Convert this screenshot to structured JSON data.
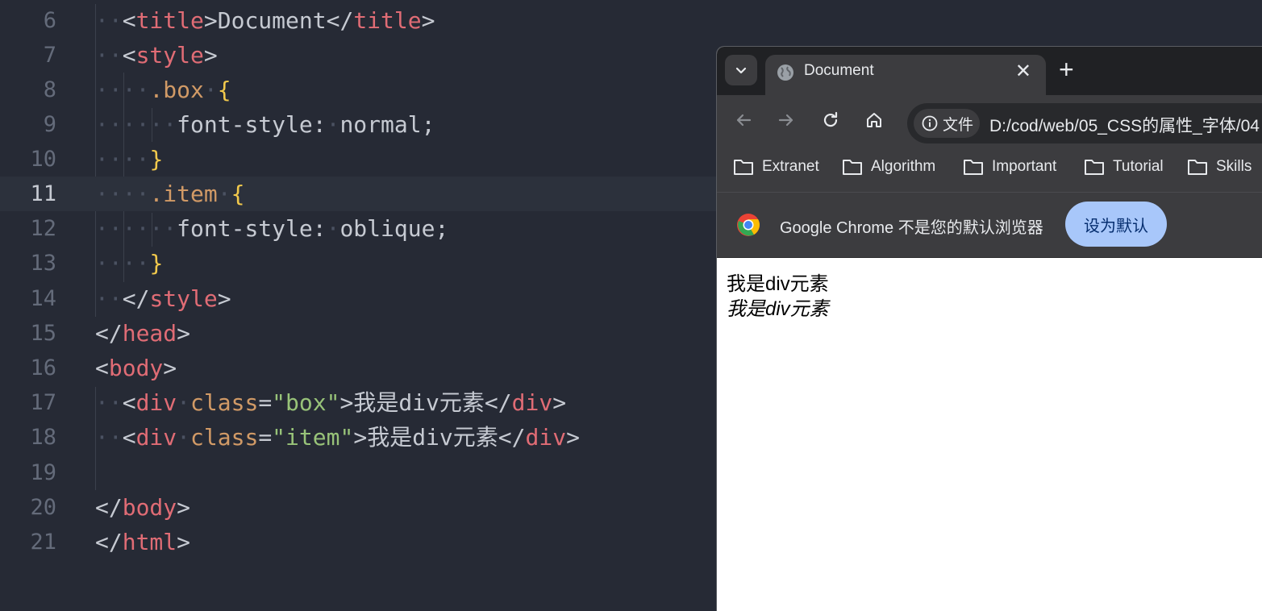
{
  "editor": {
    "line_numbers": [
      "6",
      "7",
      "8",
      "9",
      "10",
      "11",
      "12",
      "13",
      "14",
      "15",
      "16",
      "17",
      "18",
      "19",
      "20",
      "21"
    ],
    "lines": {
      "l6": {
        "open_tag": "title",
        "text": "Document",
        "close_tag": "title"
      },
      "l7": {
        "open_tag": "style"
      },
      "l8": {
        "selector": ".box",
        "brace": "{"
      },
      "l9": {
        "property": "font-style",
        "colon": ":",
        "value": "normal",
        "semi": ";"
      },
      "l10": {
        "brace": "}"
      },
      "l11": {
        "selector": ".item",
        "brace": "{"
      },
      "l12": {
        "property": "font-style",
        "colon": ":",
        "value": "oblique",
        "semi": ";"
      },
      "l13": {
        "brace": "}"
      },
      "l14": {
        "close_tag": "style"
      },
      "l15": {
        "close_tag": "head"
      },
      "l16": {
        "open_tag": "body"
      },
      "l17": {
        "tag": "div",
        "attr": "class",
        "attr_value": "\"box\"",
        "text": "我是div元素"
      },
      "l18": {
        "tag": "div",
        "attr": "class",
        "attr_value": "\"item\"",
        "text": "我是div元素"
      },
      "l20": {
        "close_tag": "body"
      },
      "l21": {
        "close_tag": "html"
      }
    },
    "current_line": "11"
  },
  "browser": {
    "tab": {
      "title": "Document",
      "close_glyph": "✕"
    },
    "new_tab_glyph": "+",
    "toolbar": {
      "site_chip_label": "文件",
      "url": "D:/cod/web/05_CSS的属性_字体/04"
    },
    "bookmarks": [
      "Extranet",
      "Algorithm",
      "Important",
      "Tutorial",
      "Skills"
    ],
    "infobar": {
      "message": "Google Chrome 不是您的默认浏览器",
      "button": "设为默认"
    },
    "page": {
      "box_text": "我是div元素",
      "item_text": "我是div元素"
    },
    "icons": {
      "tab_search": "chevron-down-icon",
      "favicon": "globe-icon",
      "back": "arrow-left-icon",
      "forward": "arrow-right-icon",
      "reload": "reload-icon",
      "home": "home-icon",
      "info": "info-icon",
      "bookmark": "folder-icon",
      "logo": "chrome-logo-icon"
    },
    "colors": {
      "tab_strip": "#202124",
      "toolbar": "#3c3c3f",
      "button": "#a8c7fa"
    }
  }
}
